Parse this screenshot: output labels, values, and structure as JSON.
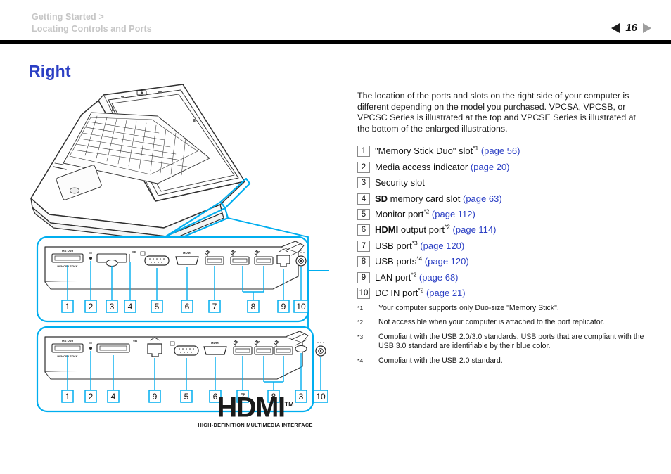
{
  "header": {
    "breadcrumb_1": "Getting Started >",
    "breadcrumb_2": "Locating Controls and Ports",
    "page_number": "16",
    "prev_icon": "triangle-left-icon",
    "next_icon": "triangle-right-icon",
    "breadcrumb_color": "#c6c6c6"
  },
  "page_title": "Right",
  "colors": {
    "heading_blue": "#2b3fc4",
    "link_blue": "#2b3fc4",
    "callout_cyan": "#00aeef",
    "rule_black": "#000000"
  },
  "intro_paragraph": "The location of the ports and slots on the right side of your computer is different depending on the model you purchased. VPCSA, VPCSB, or VPCSC Series is illustrated at the top and VPCSE Series is illustrated at the bottom of the enlarged illustrations.",
  "port_items": [
    {
      "num": "1",
      "pre": "\"Memory Stick Duo\" slot",
      "bold": "",
      "post": "",
      "sup": "*1",
      "link": "(page 56)"
    },
    {
      "num": "2",
      "pre": "Media access indicator",
      "bold": "",
      "post": "",
      "sup": "",
      "link": "(page 20)"
    },
    {
      "num": "3",
      "pre": "Security slot",
      "bold": "",
      "post": "",
      "sup": "",
      "link": ""
    },
    {
      "num": "4",
      "pre": "",
      "bold": "SD",
      "post": " memory card slot",
      "sup": "",
      "link": "(page 63)"
    },
    {
      "num": "5",
      "pre": "Monitor port",
      "bold": "",
      "post": "",
      "sup": "*2",
      "link": "(page 112)"
    },
    {
      "num": "6",
      "pre": "",
      "bold": "HDMI",
      "post": " output port",
      "sup": "*2",
      "link": "(page 114)"
    },
    {
      "num": "7",
      "pre": "USB port",
      "bold": "",
      "post": "",
      "sup": "*3",
      "link": "(page 120)"
    },
    {
      "num": "8",
      "pre": "USB ports",
      "bold": "",
      "post": "",
      "sup": "*4",
      "link": "(page 120)"
    },
    {
      "num": "9",
      "pre": "LAN port",
      "bold": "",
      "post": "",
      "sup": "*2",
      "link": "(page 68)"
    },
    {
      "num": "10",
      "pre": "DC IN port",
      "bold": "",
      "post": "",
      "sup": "*2",
      "link": "(page 21)"
    }
  ],
  "footnotes": [
    {
      "mark": "*1",
      "text": "Your computer supports only Duo-size \"Memory Stick\"."
    },
    {
      "mark": "*2",
      "text": "Not accessible when your computer is attached to the port replicator."
    },
    {
      "mark": "*3",
      "text": "Compliant with the USB 2.0/3.0 standards. USB ports that are compliant with the USB 3.0 standard are identifiable by their blue color."
    },
    {
      "mark": "*4",
      "text": "Compliant with the USB 2.0 standard."
    }
  ],
  "illustration": {
    "laptop_label": "laptop-right-side-view",
    "top_diagram_label": "VPCSA / VPCSB / VPCSC Series right side ports",
    "bottom_diagram_label": "VPCSE Series right side ports",
    "top_callout_order": [
      "1",
      "2",
      "3",
      "4",
      "5",
      "6",
      "7",
      "8",
      "9",
      "10"
    ],
    "bottom_callout_order": [
      "1",
      "2",
      "4",
      "9",
      "5",
      "6",
      "7",
      "8",
      "3",
      "10"
    ],
    "port_glyph_labels": {
      "memory_stick": "MS Duo",
      "hdmi": "HDMI",
      "sd": "SD"
    }
  },
  "hdmi_logo": {
    "word": "HDMI",
    "tm": "TM",
    "tagline": "HIGH-DEFINITION MULTIMEDIA INTERFACE"
  }
}
